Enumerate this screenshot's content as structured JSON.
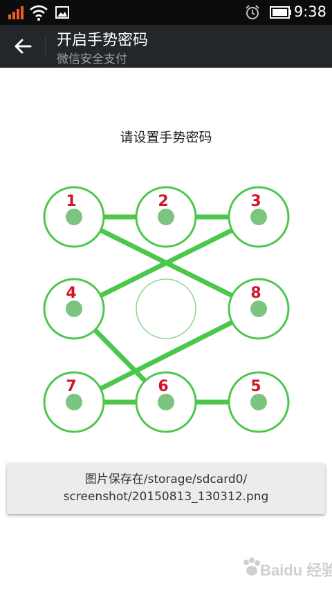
{
  "status_bar": {
    "time": "9:38",
    "icons": [
      "signal-icon",
      "wifi-icon",
      "image-notification-icon",
      "alarm-icon",
      "battery-icon"
    ]
  },
  "app_bar": {
    "title": "开启手势密码",
    "subtitle": "微信安全支付",
    "background": "#23272a"
  },
  "prompt": "请设置手势密码",
  "pattern": {
    "accent_color": "#4cc74c",
    "dot_color": "#7cc47f",
    "number_color": "#d0162a",
    "nodes": [
      {
        "label": "1",
        "row": 0,
        "col": 0,
        "numbered": true
      },
      {
        "label": "2",
        "row": 0,
        "col": 1,
        "numbered": true
      },
      {
        "label": "3",
        "row": 0,
        "col": 2,
        "numbered": true
      },
      {
        "label": "4",
        "row": 1,
        "col": 0,
        "numbered": true
      },
      {
        "label": "",
        "row": 1,
        "col": 1,
        "numbered": false
      },
      {
        "label": "8",
        "row": 1,
        "col": 2,
        "numbered": true
      },
      {
        "label": "7",
        "row": 2,
        "col": 0,
        "numbered": true
      },
      {
        "label": "6",
        "row": 2,
        "col": 1,
        "numbered": true
      },
      {
        "label": "5",
        "row": 2,
        "col": 2,
        "numbered": true
      }
    ],
    "path": [
      [
        0,
        0
      ],
      [
        0,
        1
      ],
      [
        0,
        2
      ],
      [
        1,
        0
      ],
      [
        2,
        1
      ],
      [
        2,
        2
      ],
      [
        2,
        1
      ],
      [
        2,
        0
      ],
      [
        1,
        2
      ],
      [
        0,
        0
      ]
    ]
  },
  "toast": {
    "line1": "图片保存在/storage/sdcard0/",
    "line2": "screenshot/20150813_130312.png"
  },
  "watermark": {
    "text": "Baidu 经验"
  }
}
